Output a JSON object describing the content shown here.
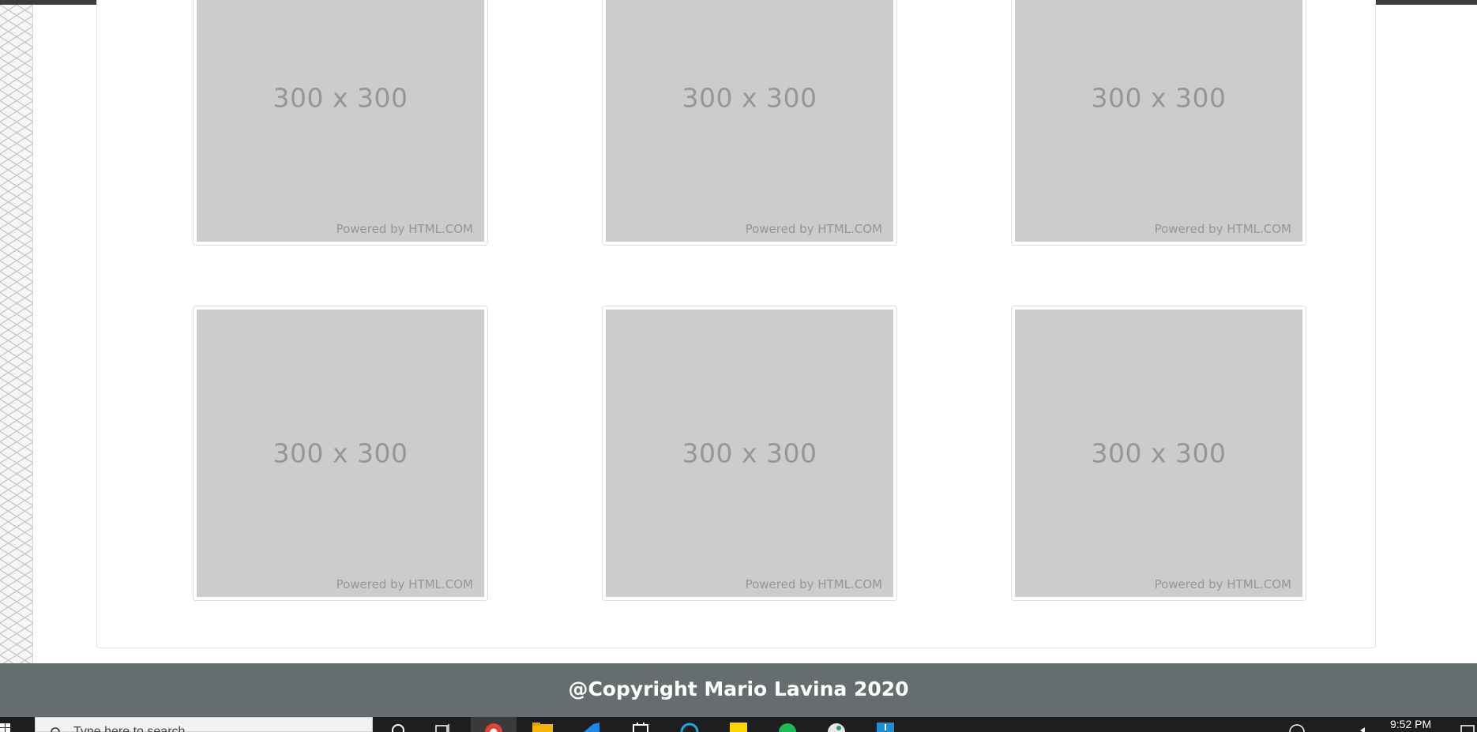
{
  "gallery": {
    "items": [
      {
        "size_text": "300 x 300",
        "credit": "Powered by HTML.COM"
      },
      {
        "size_text": "300 x 300",
        "credit": "Powered by HTML.COM"
      },
      {
        "size_text": "300 x 300",
        "credit": "Powered by HTML.COM"
      },
      {
        "size_text": "300 x 300",
        "credit": "Powered by HTML.COM"
      },
      {
        "size_text": "300 x 300",
        "credit": "Powered by HTML.COM"
      },
      {
        "size_text": "300 x 300",
        "credit": "Powered by HTML.COM"
      }
    ]
  },
  "footer": {
    "copyright": "@Copyright Mario Lavina 2020"
  },
  "taskbar": {
    "search_placeholder": "Type here to search",
    "clock": "9:52 PM",
    "icons": [
      "windows-start-icon",
      "search-icon",
      "cortana-icon",
      "task-view-icon",
      "chrome-icon",
      "file-explorer-icon",
      "vscode-icon",
      "store-icon",
      "cortana-blue-icon",
      "sticky-notes-icon",
      "spotify-icon",
      "app-icon",
      "download-icon",
      "network-icon",
      "volume-icon",
      "notification-icon"
    ]
  },
  "colors": {
    "footer_bg": "#656d6e",
    "placeholder_bg": "#cccccc",
    "taskbar_bg": "#1e1e1e"
  }
}
